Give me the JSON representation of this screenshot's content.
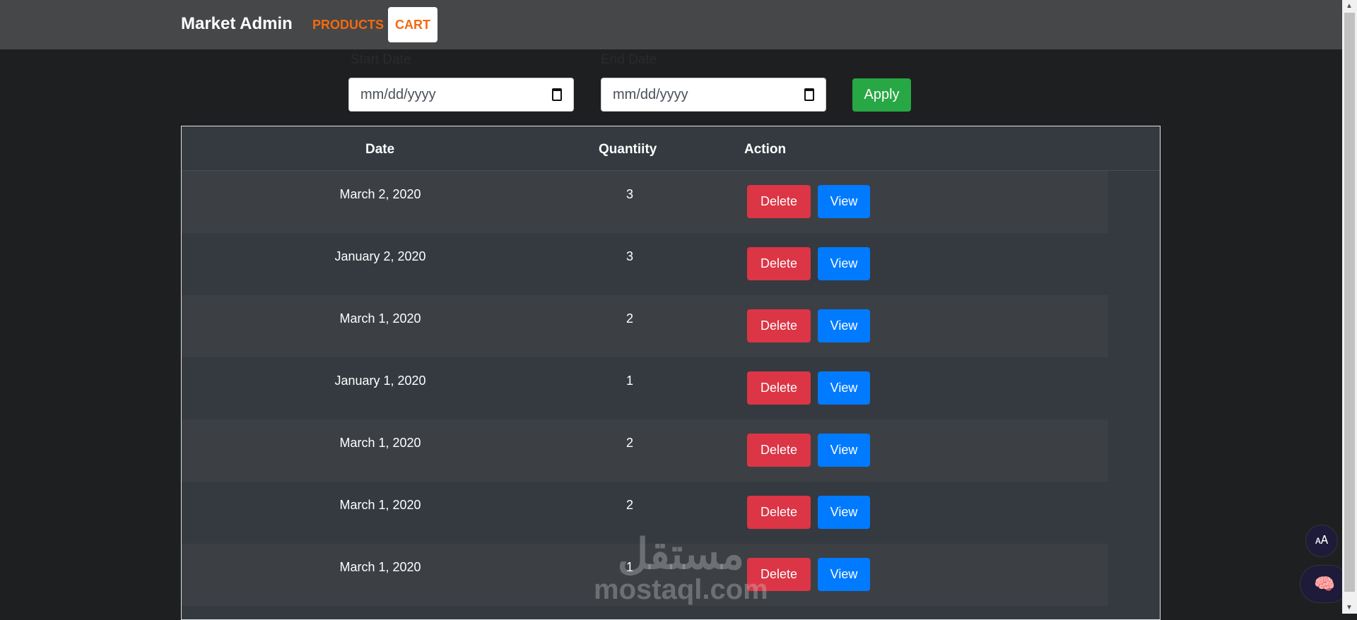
{
  "nav": {
    "brand": "Market Admin",
    "links": [
      {
        "label": "PRODUCTS"
      },
      {
        "label": "CART"
      }
    ]
  },
  "filters": {
    "start_label": "Start Date",
    "end_label": "End Date",
    "start_placeholder": "mm/dd/yyyy",
    "end_placeholder": "mm/dd/yyyy",
    "apply": "Apply"
  },
  "table": {
    "headers": [
      "Date",
      "Quantiity",
      "Action"
    ],
    "rows": [
      {
        "date": "March 2, 2020",
        "qty": "3"
      },
      {
        "date": "January 2, 2020",
        "qty": "3"
      },
      {
        "date": "March 1, 2020",
        "qty": "2"
      },
      {
        "date": "January 1, 2020",
        "qty": "1"
      },
      {
        "date": "March 1, 2020",
        "qty": "2"
      },
      {
        "date": "March 1, 2020",
        "qty": "2"
      },
      {
        "date": "March 1, 2020",
        "qty": "1"
      }
    ],
    "delete_label": "Delete",
    "view_label": "View"
  },
  "watermark": {
    "arabic": "مستقل",
    "latin": "mostaql.com"
  }
}
